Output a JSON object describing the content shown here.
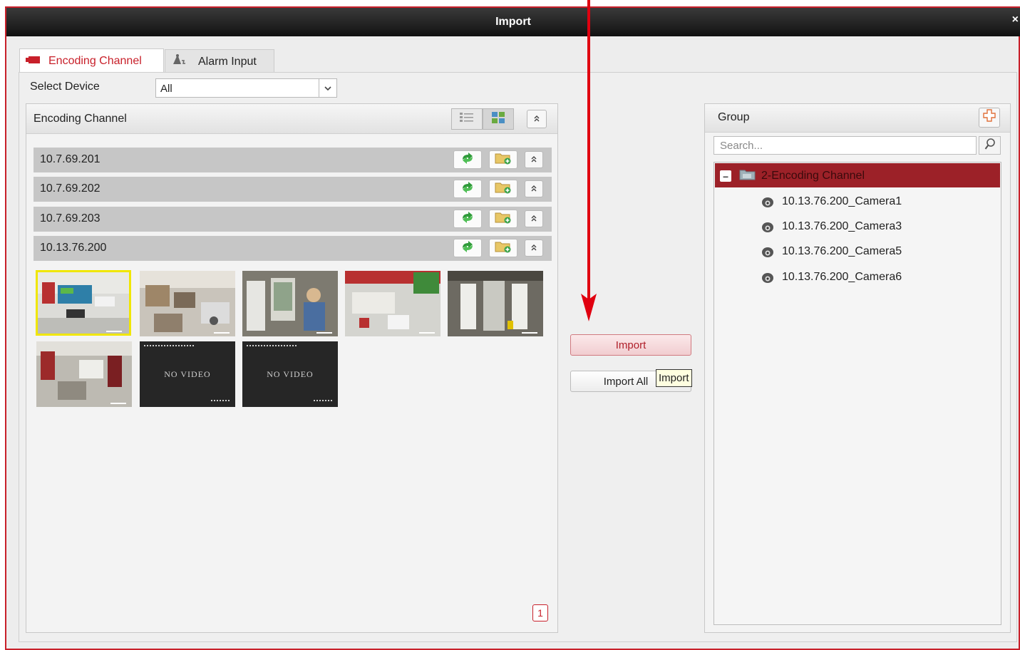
{
  "window": {
    "title": "Import",
    "close_glyph": "×"
  },
  "tabs": [
    {
      "label": "Encoding Channel",
      "icon": "camera-icon",
      "active": true
    },
    {
      "label": "Alarm Input",
      "icon": "alarm-input-icon",
      "active": false
    }
  ],
  "select_device": {
    "label": "Select Device",
    "value": "All"
  },
  "encoding_panel": {
    "title": "Encoding Channel",
    "devices": [
      {
        "ip": "10.7.69.201"
      },
      {
        "ip": "10.7.69.202"
      },
      {
        "ip": "10.7.69.203"
      },
      {
        "ip": "10.13.76.200"
      }
    ],
    "thumbnails": [
      {
        "type": "video",
        "selected": true
      },
      {
        "type": "video",
        "selected": false
      },
      {
        "type": "video",
        "selected": false
      },
      {
        "type": "video",
        "selected": false
      },
      {
        "type": "video",
        "selected": false
      },
      {
        "type": "video",
        "selected": false
      },
      {
        "type": "no_video",
        "text": "NO VIDEO"
      },
      {
        "type": "no_video",
        "text": "NO VIDEO"
      }
    ],
    "page": "1"
  },
  "actions": {
    "import_label": "Import",
    "import_all_label": "Import All",
    "tooltip": "Import"
  },
  "group_panel": {
    "title": "Group",
    "search_placeholder": "Search...",
    "root": {
      "label": "2-Encoding Channel",
      "expanded": true
    },
    "cameras": [
      {
        "label": "10.13.76.200_Camera1"
      },
      {
        "label": "10.13.76.200_Camera3"
      },
      {
        "label": "10.13.76.200_Camera5"
      },
      {
        "label": "10.13.76.200_Camera6"
      }
    ]
  },
  "colors": {
    "accent": "#c8202a",
    "tree_selected": "#9c2128",
    "tooltip_bg": "#ffffe0",
    "thumb_selected": "#f0e600"
  }
}
